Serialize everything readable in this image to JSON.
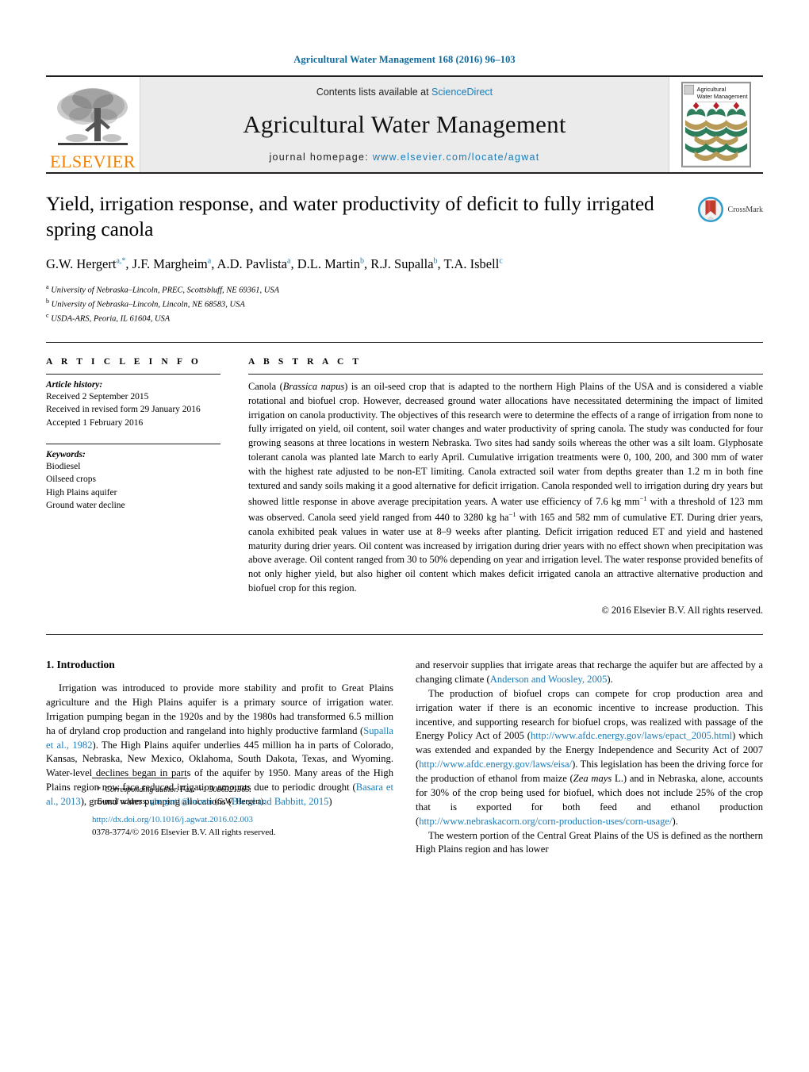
{
  "running_head": "Agricultural Water Management 168 (2016) 96–103",
  "masthead": {
    "publisher_name": "ELSEVIER",
    "contents_prefix": "Contents lists available at ",
    "contents_link": "ScienceDirect",
    "journal_title": "Agricultural Water Management",
    "homepage_prefix": "journal homepage: ",
    "homepage_url": "www.elsevier.com/locate/agwat",
    "cover_title_line1": "Agricultural",
    "cover_title_line2": "Water Management"
  },
  "article": {
    "title": "Yield, irrigation response, and water productivity of deficit to fully irrigated spring canola",
    "crossmark_label": "CrossMark",
    "authors": [
      {
        "name": "G.W. Hergert",
        "marks": "a,*"
      },
      {
        "name": "J.F. Margheim",
        "marks": "a"
      },
      {
        "name": "A.D. Pavlista",
        "marks": "a"
      },
      {
        "name": "D.L. Martin",
        "marks": "b"
      },
      {
        "name": "R.J. Supalla",
        "marks": "b"
      },
      {
        "name": "T.A. Isbell",
        "marks": "c"
      }
    ],
    "affiliations": [
      {
        "mark": "a",
        "text": "University of Nebraska–Lincoln, PREC, Scottsbluff, NE 69361, USA"
      },
      {
        "mark": "b",
        "text": "University of Nebraska–Lincoln, Lincoln, NE 68583, USA"
      },
      {
        "mark": "c",
        "text": "USDA-ARS, Peoria, IL 61604, USA"
      }
    ]
  },
  "article_info": {
    "heading": "A R T I C L E   I N F O",
    "history_label": "Article history:",
    "history": [
      "Received 2 September 2015",
      "Received in revised form 29 January 2016",
      "Accepted 1 February 2016"
    ],
    "keywords_label": "Keywords:",
    "keywords": [
      "Biodiesel",
      "Oilseed crops",
      "High Plains aquifer",
      "Ground water decline"
    ]
  },
  "abstract": {
    "heading": "A B S T R A C T",
    "p1_a": "Canola (",
    "p1_italic": "Brassica napus",
    "p1_b": ") is an oil-seed crop that is adapted to the northern High Plains of the USA and is considered a viable rotational and biofuel crop. However, decreased ground water allocations have necessitated determining the impact of limited irrigation on canola productivity. The objectives of this research were to determine the effects of a range of irrigation from none to fully irrigated on yield, oil content, soil water changes and water productivity of spring canola. The study was conducted for four growing seasons at three locations in western Nebraska. Two sites had sandy soils whereas the other was a silt loam. Glyphosate tolerant canola was planted late March to early April. Cumulative irrigation treatments were 0, 100, 200, and 300 mm of water with the highest rate adjusted to be non-ET limiting. Canola extracted soil water from depths greater than 1.2 m in both fine textured and sandy soils making it a good alternative for deficit irrigation. Canola responded well to irrigation during dry years but showed little response in above average precipitation years. A water use efficiency of 7.6 kg mm",
    "sup1": "−1",
    "p1_c": " with a threshold of 123 mm was observed. Canola seed yield ranged from 440 to 3280 kg ha",
    "sup2": "−1",
    "p1_d": " with 165 and 582 mm of cumulative ET. During drier years, canola exhibited peak values in water use at 8–9 weeks after planting. Deficit irrigation reduced ET and yield and hastened maturity during drier years. Oil content was increased by irrigation during drier years with no effect shown when precipitation was above average. Oil content ranged from 30 to 50% depending on year and irrigation level. The water response provided benefits of not only higher yield, but also higher oil content which makes deficit irrigated canola an attractive alternative production and biofuel crop for this region.",
    "copyright": "© 2016 Elsevier B.V. All rights reserved."
  },
  "body": {
    "section_number_title": "1.  Introduction",
    "left_p1_a": "Irrigation was introduced to provide more stability and profit to Great Plains agriculture and the High Plains aquifer is a primary source of irrigation water. Irrigation pumping began in the 1920s and by the 1980s had transformed 6.5 million ha of dryland crop production and rangeland into highly productive farmland (",
    "left_cite1": "Supalla et al., 1982",
    "left_p1_b": "). The High Plains aquifer underlies 445 million ha in parts of Colorado, Kansas, Nebraska, New Mexico, Oklahoma, South Dakota, Texas, and Wyoming. Water-level declines began in parts of the aquifer by 1950. Many areas of the High Plains region now face reduced irrigation amounts due to periodic drought (",
    "left_cite2": "Basara et al., 2013",
    "left_p1_c": "), ground water pumping allocations (",
    "left_cite3": "Bleed and Babbitt, 2015",
    "left_p1_d": ")",
    "right_p0_a": "and reservoir supplies that irrigate areas that recharge the aquifer but are affected by a changing climate (",
    "right_cite0": "Anderson and Woosley, 2005",
    "right_p0_b": ").",
    "right_p1_a": "The production of biofuel crops can compete for crop production area and irrigation water if there is an economic incentive to increase production. This incentive, and supporting research for biofuel crops, was realized with passage of the Energy Policy Act of 2005 (",
    "right_link1": "http://www.afdc.energy.gov/laws/epact_2005.html",
    "right_p1_b": ") which was extended and expanded by the Energy Independence and Security Act of 2007 (",
    "right_link2": "http://www.afdc.energy.gov/laws/eisa/",
    "right_p1_c": "). This legislation has been the driving force for the production of ethanol from maize (",
    "right_italic1": "Zea mays",
    "right_p1_d": " L.) and in Nebraska, alone, accounts for 30% of the crop being used for biofuel, which does not include 25% of the crop that is exported for both feed and ethanol production (",
    "right_link3": "http://www.nebraskacorn.org/corn-production-uses/corn-usage/",
    "right_p1_e": ").",
    "right_p2": "The western portion of the Central Great Plains of the US is defined as the northern High Plains region and has lower"
  },
  "footnotes": {
    "corresponding_star": "*",
    "corresponding": "Corresponding author. Fax: +1 3086321365.",
    "email_label": "E-mail address:",
    "email": "ghergert1@unl.edu",
    "email_suffix": "(G.W. Hergert).",
    "doi": "http://dx.doi.org/10.1016/j.agwat.2016.02.003",
    "issn": "0378-3774/© 2016 Elsevier B.V. All rights reserved."
  },
  "colors": {
    "link": "#1a7cb8",
    "elsevier_orange": "#f08200",
    "rule": "#231f20",
    "masthead_bg": "#ebebeb"
  }
}
